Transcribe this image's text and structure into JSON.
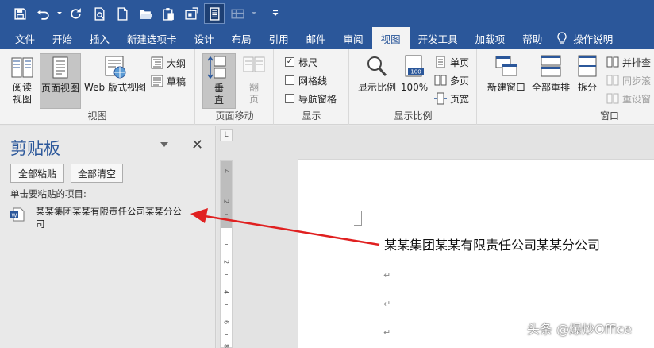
{
  "qat": {
    "icons": [
      "save-icon",
      "undo-icon",
      "redo-icon",
      "print-preview-icon",
      "new-document-icon",
      "open-folder-icon",
      "paste-icon",
      "screenshot-icon",
      "read-mode-icon",
      "table-icon",
      "customize-icon"
    ]
  },
  "tabs": [
    "文件",
    "开始",
    "插入",
    "新建选项卡",
    "设计",
    "布局",
    "引用",
    "邮件",
    "审阅",
    "视图",
    "开发工具",
    "加载项",
    "帮助"
  ],
  "active_tab": "视图",
  "tell_me": "操作说明",
  "ribbon": {
    "views": {
      "label": "视图",
      "read_mode": "阅读\n视图",
      "print_layout": "页面视图",
      "web_layout": "Web 版式视图",
      "outline": "大纲",
      "draft": "草稿"
    },
    "page_movement": {
      "label": "页面移动",
      "vertical": "垂\n直",
      "side_to_side": "翻\n页"
    },
    "show": {
      "label": "显示",
      "ruler": "标尺",
      "ruler_checked": true,
      "gridlines": "网格线",
      "gridlines_checked": false,
      "nav_pane": "导航窗格",
      "nav_pane_checked": false
    },
    "zoom": {
      "label": "显示比例",
      "zoom": "显示比例",
      "hundred": "100%",
      "hundred_badge": "100",
      "one_page": "单页",
      "multi_page": "多页",
      "page_width": "页宽"
    },
    "window": {
      "label": "窗口",
      "new_window": "新建窗口",
      "arrange_all": "全部重排",
      "split": "拆分",
      "side_by_side": "并排查",
      "sync_scroll": "同步滚",
      "reset_position": "重设窗"
    }
  },
  "clipboard_pane": {
    "title": "剪贴板",
    "paste_all": "全部粘贴",
    "clear_all": "全部清空",
    "hint": "单击要粘贴的项目:",
    "items": [
      {
        "text": "某某集团某某有限责任公司某某分公司"
      }
    ]
  },
  "document": {
    "ruler_corner": "L",
    "ruler_numbers": [
      "4",
      "2",
      "",
      "2",
      "4",
      "6",
      "8"
    ],
    "line1": "某某集团某某有限责任公司某某分公司",
    "para_mark": "↵"
  },
  "colors": {
    "accent": "#2b579a",
    "arrow": "#e02020"
  },
  "watermark": "头条 @爆炒Office"
}
